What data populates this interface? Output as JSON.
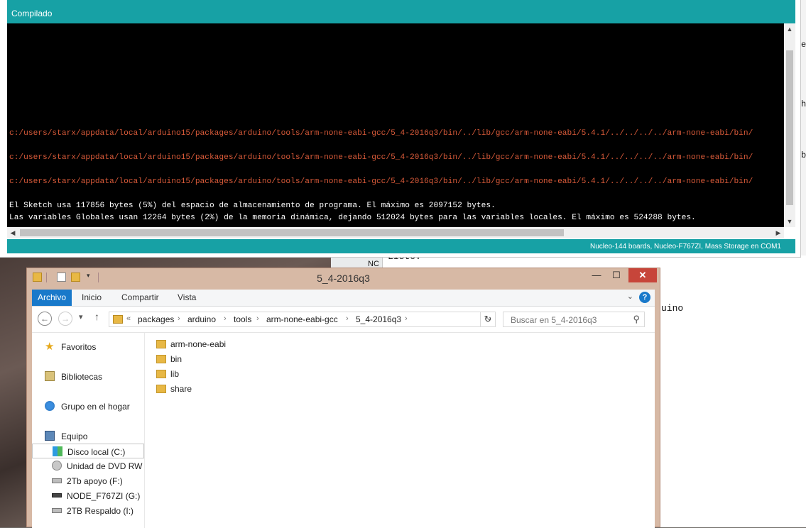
{
  "arduino": {
    "status_text": "Compilado",
    "console_lines": [
      {
        "text": "c:/users/starx/appdata/local/arduino15/packages/arduino/tools/arm-none-eabi-gcc/5_4-2016q3/bin/../lib/gcc/arm-none-eabi/5.4.1/../../../../arm-none-eabi/bin/",
        "kind": "error"
      },
      {
        "text": "c:/users/starx/appdata/local/arduino15/packages/arduino/tools/arm-none-eabi-gcc/5_4-2016q3/bin/../lib/gcc/arm-none-eabi/5.4.1/../../../../arm-none-eabi/bin/",
        "kind": "error"
      },
      {
        "text": "c:/users/starx/appdata/local/arduino15/packages/arduino/tools/arm-none-eabi-gcc/5_4-2016q3/bin/../lib/gcc/arm-none-eabi/5.4.1/../../../../arm-none-eabi/bin/",
        "kind": "error"
      },
      {
        "text": "El Sketch usa 117856 bytes (5%) del espacio de almacenamiento de programa. El máximo es 2097152 bytes.",
        "kind": "info"
      },
      {
        "text": "Las variables Globales usan 12264 bytes (2%) de la memoria dinámica, dejando 512024 bytes para las variables locales. El máximo es 524288 bytes.",
        "kind": "info"
      }
    ],
    "footer_board": "Nucleo-144 boards, Nucleo-F767ZI, Mass Storage en COM1",
    "colors": {
      "accent": "#17a1a5",
      "console_bg": "#000000",
      "error_text": "#d85a39"
    }
  },
  "background": {
    "fragments": [
      "NC",
      "Listo.",
      "uino",
      "h",
      "b",
      "e"
    ]
  },
  "explorer": {
    "title": "5_4-2016q3",
    "window_buttons": {
      "minimize": "—",
      "maximize": "☐",
      "close": "✕"
    },
    "ribbon_tabs": [
      "Archivo",
      "Inicio",
      "Compartir",
      "Vista"
    ],
    "breadcrumb_prefix": "«",
    "breadcrumb": [
      "packages",
      "arduino",
      "tools",
      "arm-none-eabi-gcc",
      "5_4-2016q3"
    ],
    "search_placeholder": "Buscar en 5_4-2016q3",
    "nav_items": [
      {
        "label": "Favoritos",
        "icon": "star-icon"
      },
      {
        "label": "Bibliotecas",
        "icon": "library-icon"
      },
      {
        "label": "Grupo en el hogar",
        "icon": "homegroup-icon"
      },
      {
        "label": "Equipo",
        "icon": "computer-icon"
      },
      {
        "label": "Disco local (C:)",
        "icon": "windows-drive-icon"
      },
      {
        "label": "Unidad de DVD RW (",
        "icon": "dvd-drive-icon"
      },
      {
        "label": "2Tb apoyo (F:)",
        "icon": "drive-icon"
      },
      {
        "label": "NODE_F767ZI (G:)",
        "icon": "drive-icon"
      },
      {
        "label": "2TB Respaldo (I:)",
        "icon": "drive-icon"
      }
    ],
    "selected_nav": "Disco local (C:)",
    "files": [
      "arm-none-eabi",
      "bin",
      "lib",
      "share"
    ]
  }
}
